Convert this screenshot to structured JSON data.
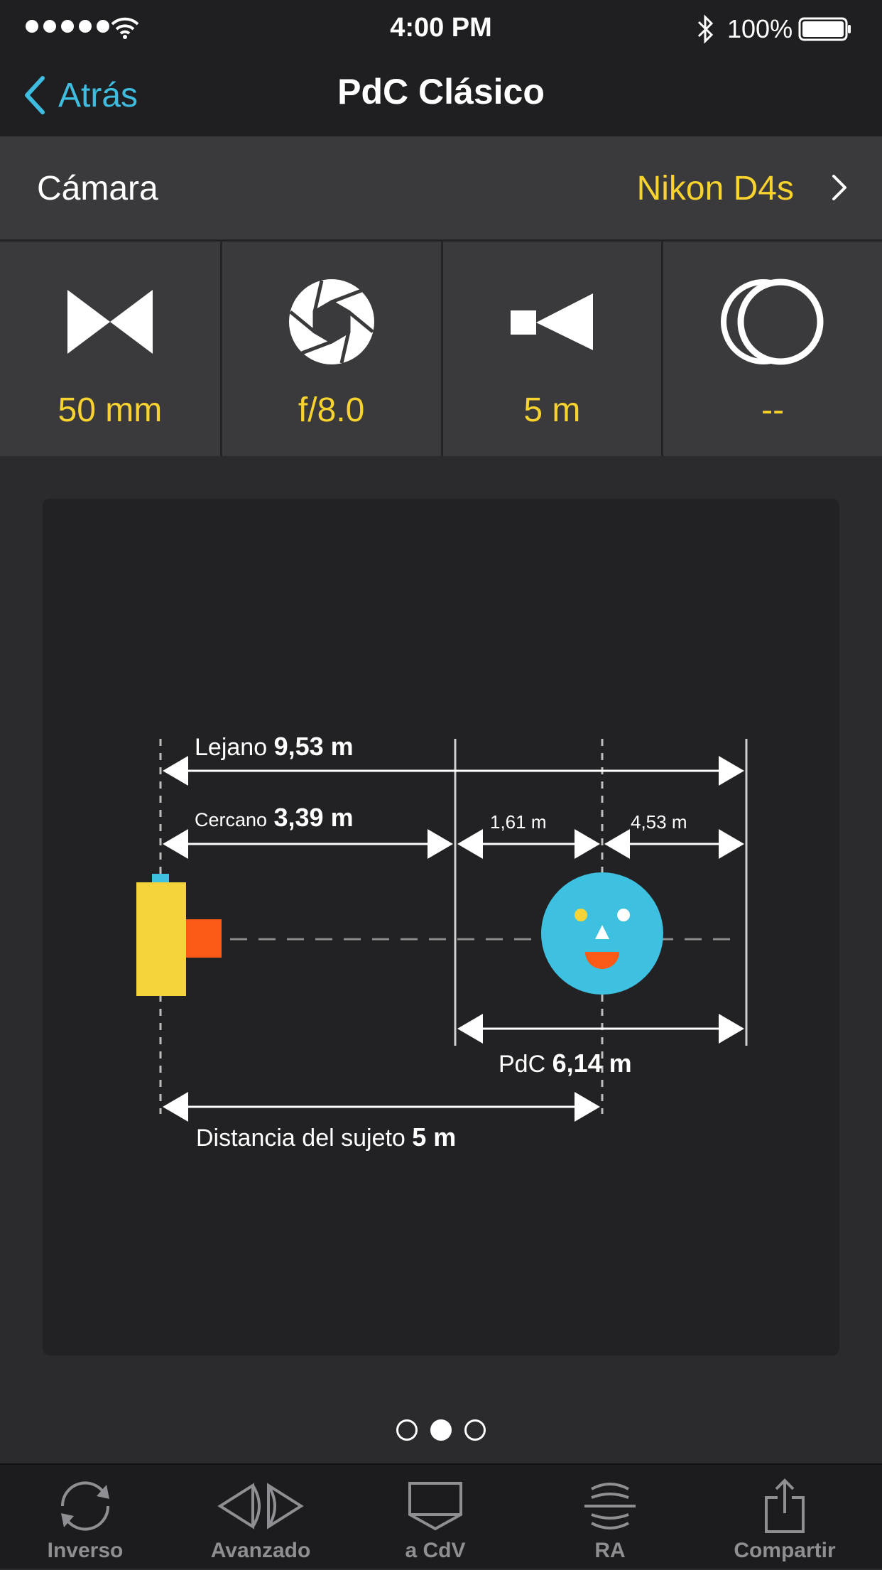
{
  "status_bar": {
    "time": "4:00 PM",
    "battery": "100%"
  },
  "nav": {
    "back_label": "Atrás",
    "title": "PdC Clásico"
  },
  "camera": {
    "label": "Cámara",
    "value": "Nikon D4s"
  },
  "params": [
    {
      "icon": "focal-length-icon",
      "value": "50 mm"
    },
    {
      "icon": "aperture-icon",
      "value": "f/8.0"
    },
    {
      "icon": "subject-distance-icon",
      "value": "5 m"
    },
    {
      "icon": "teleconverter-icon",
      "value": "--"
    }
  ],
  "diagram": {
    "far_label": "Lejano",
    "far_value": "9,53 m",
    "near_label": "Cercano",
    "near_value": "3,39 m",
    "front_dof": "1,61 m",
    "rear_dof": "4,53 m",
    "dof_label": "PdC",
    "dof_value": "6,14 m",
    "subject_label": "Distancia del sujeto",
    "subject_value": "5 m"
  },
  "pager": {
    "pages": 3,
    "active": 1
  },
  "tabs": [
    {
      "icon": "rotate-icon",
      "label": "Inverso"
    },
    {
      "icon": "advanced-icon",
      "label": "Avanzado"
    },
    {
      "icon": "coc-icon",
      "label": "a CdV"
    },
    {
      "icon": "ar-icon",
      "label": "RA"
    },
    {
      "icon": "share-icon",
      "label": "Compartir"
    }
  ],
  "colors": {
    "accent_blue": "#3fbde0",
    "value_yellow": "#f8d32f",
    "camera_body": "#f5d33a",
    "camera_lens": "#fb5a16",
    "subject_face": "#3ec1e0"
  }
}
